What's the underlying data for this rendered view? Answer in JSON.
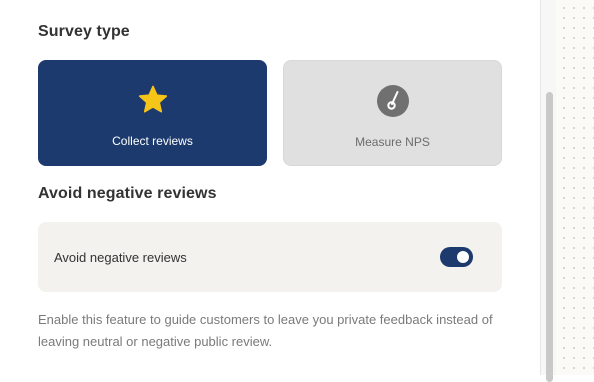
{
  "survey_type": {
    "title": "Survey type",
    "options": [
      {
        "label": "Collect reviews",
        "icon": "star-icon",
        "selected": true
      },
      {
        "label": "Measure NPS",
        "icon": "gauge-icon",
        "selected": false
      }
    ]
  },
  "avoid_negative": {
    "title": "Avoid negative reviews",
    "toggle_label": "Avoid negative reviews",
    "enabled": true,
    "description": "Enable this feature to guide customers to leave you private feedback instead of leaving neutral or negative public review."
  },
  "colors": {
    "accent": "#1d3a6e",
    "star": "#f5c518",
    "card_unselected": "#e0e0e0",
    "toggle_row_bg": "#f3f2ef"
  }
}
